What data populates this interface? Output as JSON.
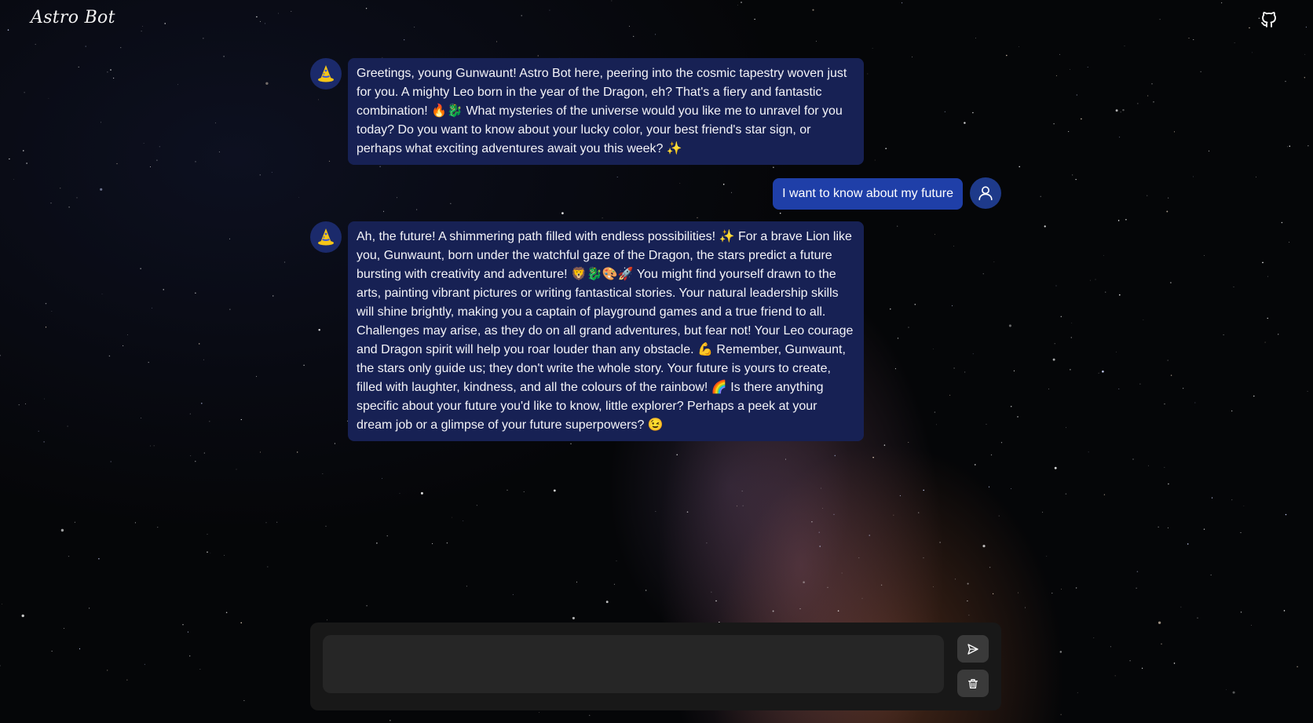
{
  "app": {
    "title": "Astro Bot"
  },
  "header": {
    "github_icon": "github-icon"
  },
  "messages": [
    {
      "role": "bot",
      "avatar_icon": "wizard-hat-icon",
      "text": "Greetings, young Gunwaunt! Astro Bot here, peering into the cosmic tapestry woven just for you. A mighty Leo born in the year of the Dragon, eh? That's a fiery and fantastic combination! 🔥🐉 What mysteries of the universe would you like me to unravel for you today? Do you want to know about your lucky color, your best friend's star sign, or perhaps what exciting adventures await you this week? ✨"
    },
    {
      "role": "user",
      "avatar_icon": "user-icon",
      "text": "I want to know about my future"
    },
    {
      "role": "bot",
      "avatar_icon": "wizard-hat-icon",
      "text": "Ah, the future! A shimmering path filled with endless possibilities! ✨ For a brave Lion like you, Gunwaunt, born under the watchful gaze of the Dragon, the stars predict a future bursting with creativity and adventure! 🦁🐉🎨🚀 You might find yourself drawn to the arts, painting vibrant pictures or writing fantastical stories. Your natural leadership skills will shine brightly, making you a captain of playground games and a true friend to all. Challenges may arise, as they do on all grand adventures, but fear not! Your Leo courage and Dragon spirit will help you roar louder than any obstacle. 💪 Remember, Gunwaunt, the stars only guide us; they don't write the whole story. Your future is yours to create, filled with laughter, kindness, and all the colours of the rainbow! 🌈 Is there anything specific about your future you'd like to know, little explorer? Perhaps a peek at your dream job or a glimpse of your future superpowers? 😉"
    }
  ],
  "composer": {
    "input_value": "",
    "send_icon": "send-icon",
    "clear_icon": "trash-icon"
  },
  "colors": {
    "bot_bubble": "#172154",
    "user_bubble": "#1f3fa8",
    "avatar_bg": "#1b2a6b",
    "composer_bg": "#181818",
    "input_bg": "#262626",
    "button_bg": "#3a3a3a"
  }
}
